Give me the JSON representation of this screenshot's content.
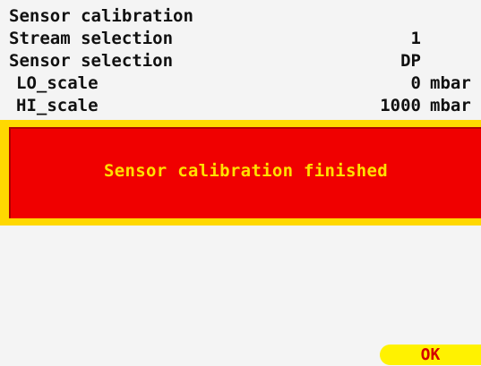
{
  "rows": [
    {
      "label": "Sensor calibration",
      "value": "",
      "unit": ""
    },
    {
      "label": "Stream selection",
      "value": "1",
      "unit": ""
    },
    {
      "label": "Sensor selection",
      "value": "DP",
      "unit": ""
    },
    {
      "label": "LO_scale",
      "value": "0",
      "unit": "mbar"
    },
    {
      "label": "HI_scale",
      "value": "1000",
      "unit": "mbar"
    }
  ],
  "dialog": {
    "message": "Sensor calibration finished"
  },
  "softkeys": {
    "ok_label": "OK"
  },
  "colors": {
    "dialog_fill": "#f00000",
    "dialog_border": "#ffd800",
    "dialog_text": "#ffe000",
    "ok_button": "#fff200",
    "ok_text": "#d40000"
  }
}
